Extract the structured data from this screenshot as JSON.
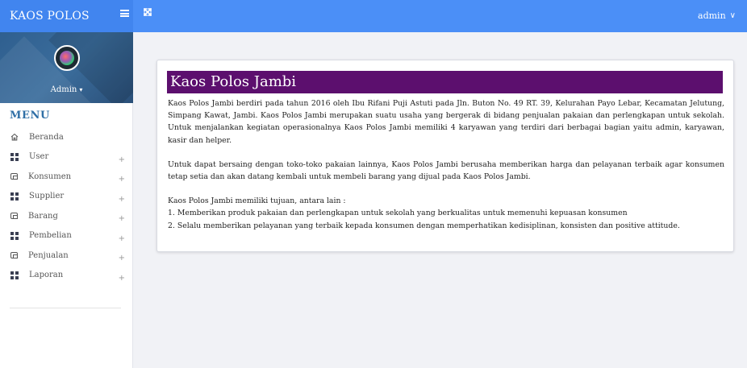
{
  "topbar": {
    "brand": "KAOS POLOS",
    "user_label": "admin",
    "user_chevron": "∨"
  },
  "sidebar": {
    "profile_name": "Admin",
    "profile_caret": "▾",
    "menu_title": "MENU",
    "items": [
      {
        "label": "Beranda",
        "icon": "home-icon",
        "expandable": false
      },
      {
        "label": "User",
        "icon": "grid-icon",
        "expandable": true
      },
      {
        "label": "Konsumen",
        "icon": "chat-icon",
        "expandable": true
      },
      {
        "label": "Supplier",
        "icon": "grid-icon",
        "expandable": true
      },
      {
        "label": "Barang",
        "icon": "chat-icon",
        "expandable": true
      },
      {
        "label": "Pembelian",
        "icon": "grid-icon",
        "expandable": true
      },
      {
        "label": "Penjualan",
        "icon": "chat-icon",
        "expandable": true
      },
      {
        "label": "Laporan",
        "icon": "grid-icon",
        "expandable": true
      }
    ],
    "expand_symbol": "+"
  },
  "content": {
    "title": "Kaos Polos Jambi",
    "paragraph1": "Kaos Polos Jambi berdiri pada tahun 2016 oleh Ibu Rifani Puji Astuti pada Jln. Buton No. 49 RT. 39, Kelurahan Payo Lebar, Kecamatan Jelutung, Simpang Kawat, Jambi. Kaos Polos Jambi merupakan suatu usaha yang bergerak di bidang penjualan pakaian dan perlengkapan untuk sekolah. Untuk menjalankan kegiatan operasionalnya Kaos Polos Jambi memiliki 4 karyawan yang terdiri dari berbagai bagian yaitu admin, karyawan, kasir dan helper.",
    "paragraph2": "Untuk dapat bersaing dengan toko-toko pakaian lainnya, Kaos Polos Jambi berusaha memberikan harga dan pelayanan terbaik agar konsumen tetap setia dan akan datang kembali untuk membeli barang yang dijual pada Kaos Polos Jambi.",
    "goals_intro": "Kaos Polos Jambi memiliki tujuan, antara lain :",
    "goal1": "1. Memberikan produk pakaian dan perlengkapan untuk sekolah yang berkualitas untuk memenuhi kepuasan konsumen",
    "goal2": "2. Selalu memberikan pelayanan yang terbaik kepada konsumen dengan memperhatikan kedisiplinan, konsisten dan positive attitude."
  },
  "colors": {
    "topbar": "#4b8ff7",
    "title_bar": "#5c0f6e",
    "menu_title": "#2f6fa6"
  }
}
